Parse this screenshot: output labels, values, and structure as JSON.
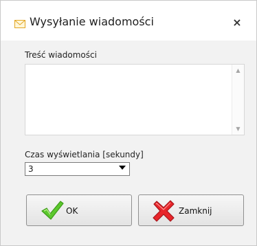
{
  "window": {
    "title": "Wysyłanie wiadomości",
    "close_glyph": "×"
  },
  "form": {
    "message_label": "Treść wiadomości",
    "message_value": "",
    "display_time_label": "Czas wyświetlania [sekundy]",
    "display_time_value": "3"
  },
  "buttons": {
    "ok_label": "OK",
    "close_label": "Zamknij"
  },
  "icons": {
    "title": "envelope-icon",
    "ok": "checkmark-icon",
    "close": "red-x-icon"
  },
  "colors": {
    "client_bg": "#f2f2f2",
    "check_green": "#5cc82e",
    "x_red": "#e8262b",
    "envelope": "#f0b82e"
  }
}
